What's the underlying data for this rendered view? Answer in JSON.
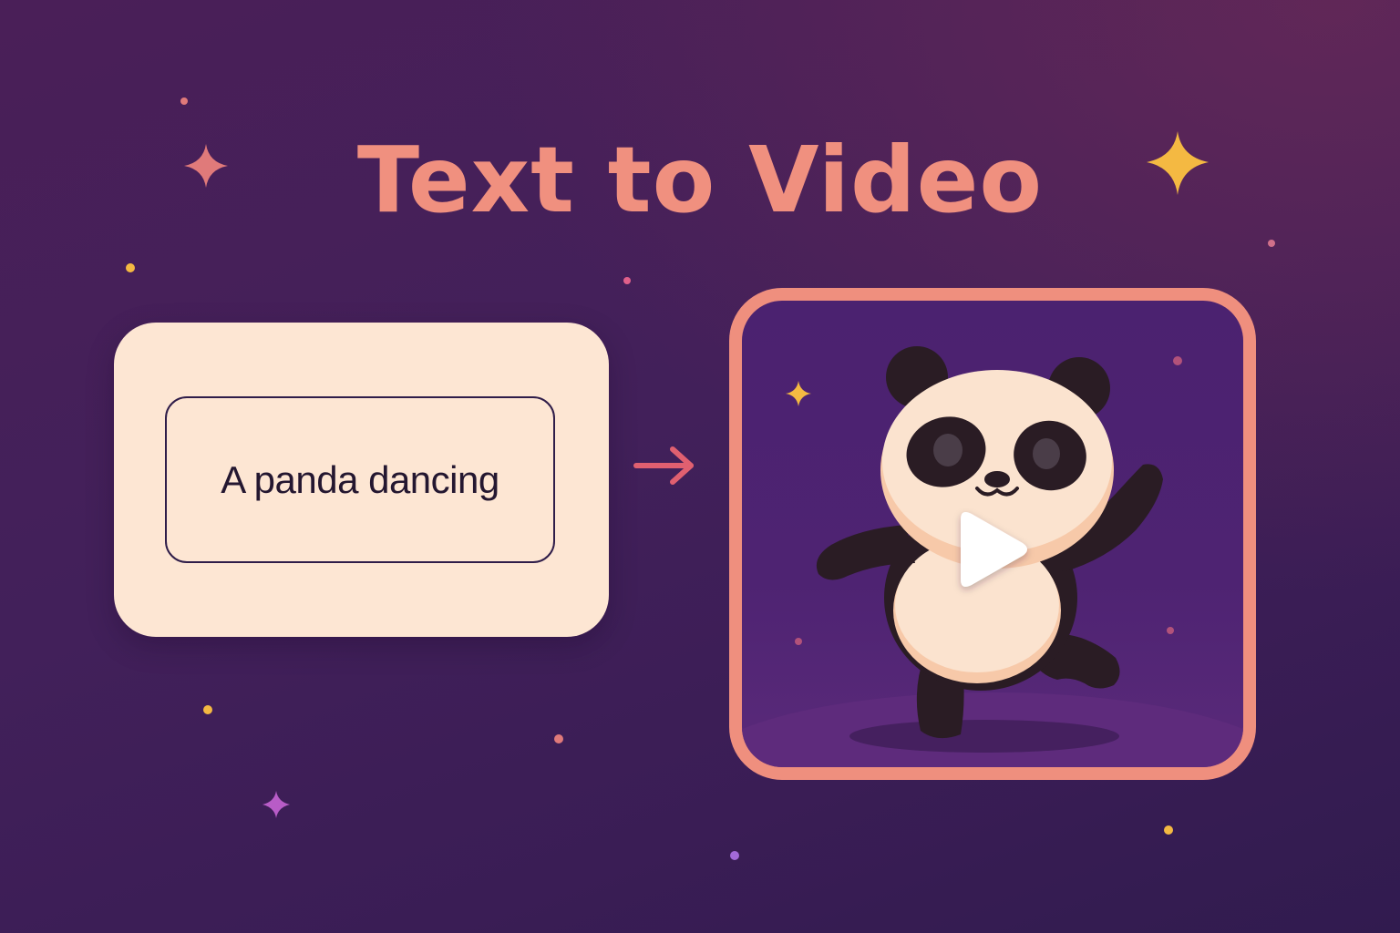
{
  "title": "Text to Video",
  "prompt": {
    "text": "A panda dancing"
  },
  "video": {
    "subject": "dancing panda",
    "play_icon": "play-icon"
  },
  "arrow_icon": "arrow-right-icon",
  "colors": {
    "background_top": "#4a1f58",
    "background_bottom": "#311b4f",
    "title": "#f0907f",
    "card": "#fde6d3",
    "frame_border": "#ef8f7e",
    "video_bg": "#4b2270",
    "arrow": "#e06070",
    "star_gold": "#f4b942",
    "star_pink": "#e07a7a",
    "star_purple": "#b85cc7",
    "panda_black": "#2a1c24",
    "panda_cream": "#fbe3cf"
  },
  "icons": [
    "sparkle-icon",
    "arrow-right-icon",
    "play-icon"
  ]
}
